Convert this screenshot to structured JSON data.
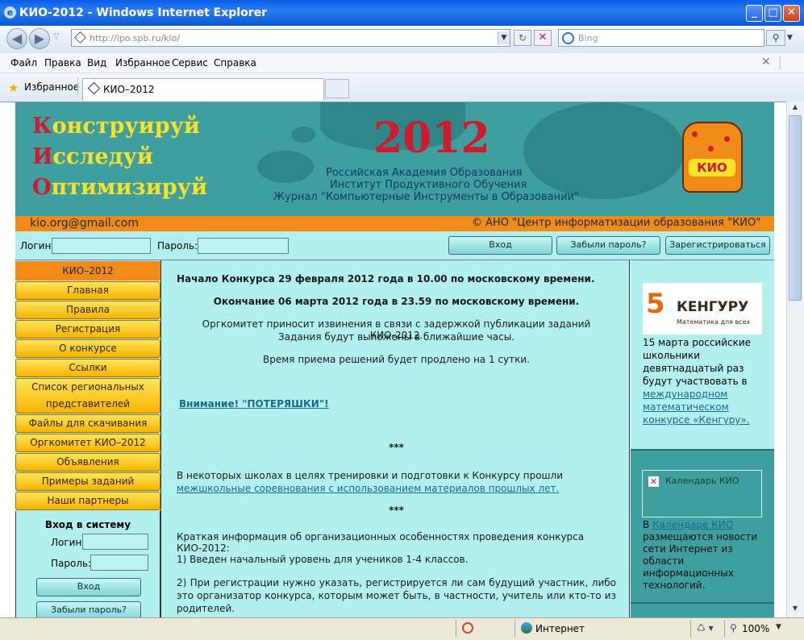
{
  "window": {
    "title": "КИО-2012 - Windows Internet Explorer",
    "min": "_",
    "max": "□",
    "close": "✕"
  },
  "toolbar": {
    "url": "http://ipo.spb.ru/kio/",
    "search_placeholder": "Bing"
  },
  "menu": [
    "Файл",
    "Правка",
    "Вид",
    "Избранное",
    "Сервис",
    "Справка"
  ],
  "favorites": {
    "label": "Избранное",
    "tab_title": "КИО–2012"
  },
  "header": {
    "line1_cap": "К",
    "line1_rest": "онструируй",
    "line2_cap": "И",
    "line2_rest": "сследуй",
    "line3_cap": "О",
    "line3_rest": "птимизируй",
    "year": "2012",
    "org1": "Российская Академия Образования",
    "org2": "Институт Продуктивного Обучения",
    "org3": "Журнал \"Компьютерные Инструменты в Образовании\"",
    "email": "kio.org@gmail.com",
    "copyright": "© АНО \"Центр информатизации образования \"КИО\"",
    "mascot_label": "КИО"
  },
  "login": {
    "login_label": "Логин:",
    "password_label": "Пароль:",
    "login_btn": "Вход",
    "forgot_btn": "Забыли пароль?",
    "register_btn": "Зарегистрироваться"
  },
  "sidebar": {
    "head": "КИО–2012",
    "items": [
      "Главная",
      "Правила",
      "Регистрация",
      "О конкурсе",
      "Ссылки",
      "Список региональных представителей",
      "Файлы для скачивания",
      "Оргкомитет КИО–2012",
      "Объявления",
      "Примеры заданий",
      "Наши партнеры"
    ],
    "signin_title": "Вход в систему",
    "login_label": "Логин:",
    "password_label": "Пароль:",
    "login_btn": "Вход",
    "forgot_btn": "Забыли пароль?"
  },
  "main": {
    "p1": "Начало Конкурса  29 февраля 2012 года в 10.00 по московскому времени.",
    "p2": "Окончание 06 марта 2012 года в 23.59 по московскому времени.",
    "p3a": "Оргкомитет приносит извинения в связи с задержкой публикации заданий КИО-2012.",
    "p3b": "Задания будут выложены в ближайшие часы.",
    "p4": "Время приема решений будет продлено на 1 сутки.",
    "attention": "Внимание! \"ПОТЕРЯШКИ\"!",
    "stars": "***",
    "p5a": "В некоторых школах в целях тренировки и подготовки к Конкурсу прошли ",
    "p5_link": "межшкольные соревнования с использованием  материалов прошлых лет.",
    "p6": "Краткая информация об организационных особенностях проведения конкурса КИО-2012:",
    "p7": "1) Введен начальный уровень для учеников 1-4 классов.",
    "p8": "2) При регистрации нужно указать, регистрируется ли сам будущий участник, либо это организатор конкурса, которым может быть, в частности, учитель или кто-то из родителей."
  },
  "right": {
    "kangaroo_logo": "КЕНГУРУ",
    "kangaroo_sub": "Математика для всех",
    "kangaroo_text": "15 марта российские школьники девятнадцатый раз будут участвовать в ",
    "kangaroo_link": "международном математическом конкурсе «Кенгуру».",
    "calendar_img": "Календарь КИО",
    "cal_prefix": "В ",
    "cal_link": "Календаре КИО",
    "cal_text": " размещаются новости сети Интернет из области информационных технологий."
  },
  "status": {
    "zone": "Интернет",
    "zoom": "100%"
  }
}
